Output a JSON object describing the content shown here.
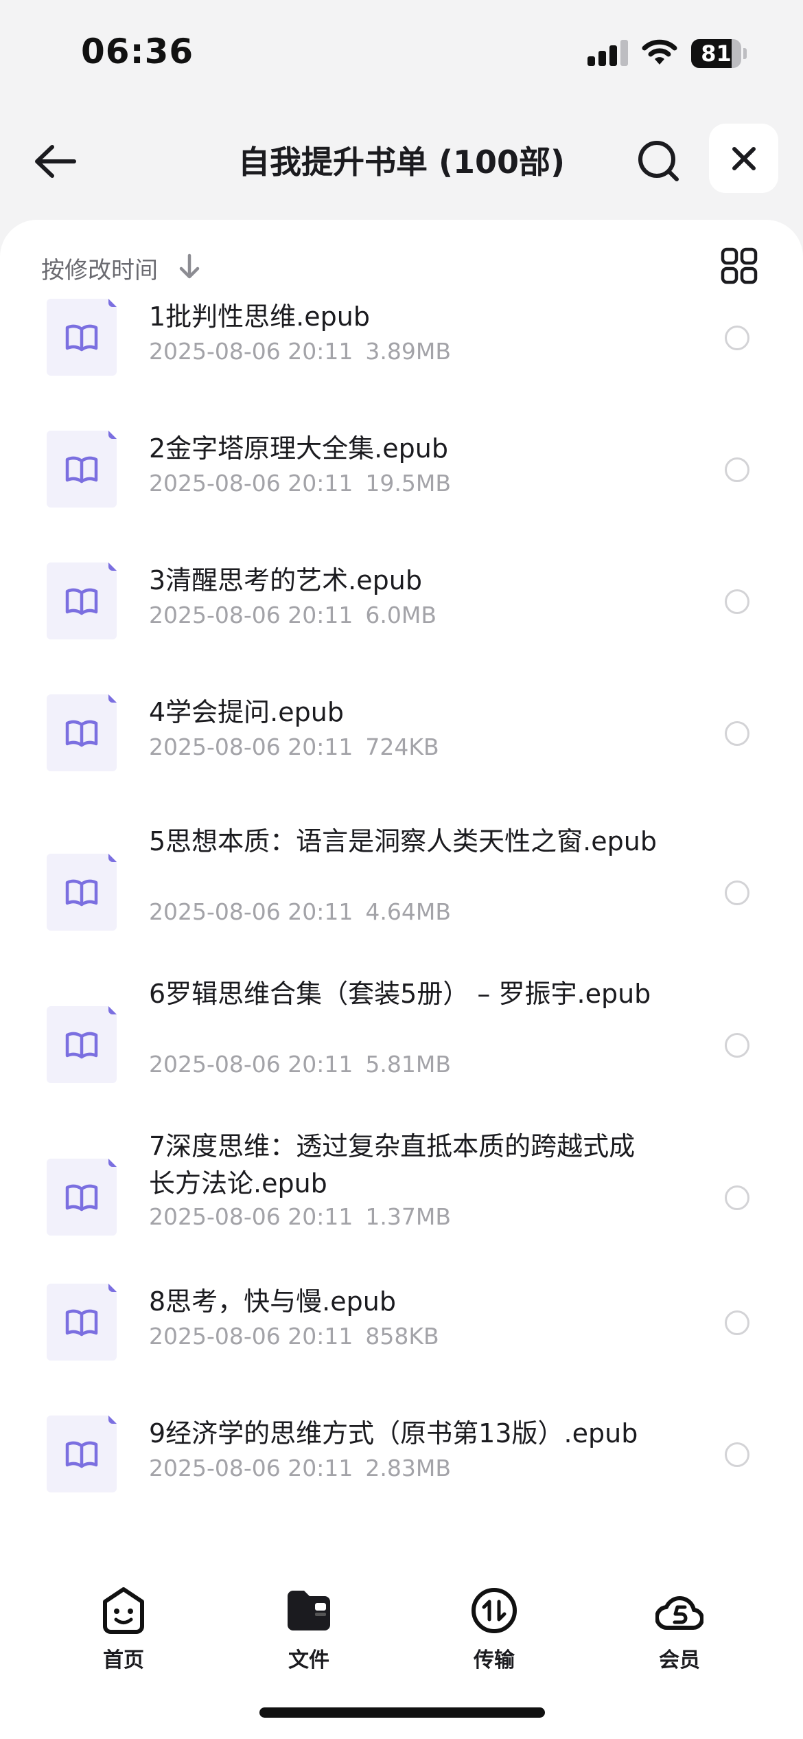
{
  "status_bar": {
    "time": "06:36",
    "battery": "81",
    "battery_level": 0.81
  },
  "nav": {
    "title": "自我提升书单 (100部)",
    "back_icon": "arrow-left-icon",
    "search_icon": "search-icon",
    "close_icon": "close-icon"
  },
  "sort": {
    "label": "按修改时间",
    "direction_icon": "arrow-down-icon",
    "view_icon": "grid-view-icon"
  },
  "files": [
    {
      "name": "1批判性思维.epub",
      "date": "2025-08-06 20:11",
      "size": "3.89MB"
    },
    {
      "name": "2金字塔原理大全集.epub",
      "date": "2025-08-06 20:11",
      "size": "19.5MB"
    },
    {
      "name": "3清醒思考的艺术.epub",
      "date": "2025-08-06 20:11",
      "size": "6.0MB"
    },
    {
      "name": "4学会提问.epub",
      "date": "2025-08-06 20:11",
      "size": "724KB"
    },
    {
      "name": "5思想本质：语言是洞察人类天性之窗.epub",
      "date": "2025-08-06 20:11",
      "size": "4.64MB"
    },
    {
      "name": "6罗辑思维合集（套装5册） – 罗振宇.epub",
      "date": "2025-08-06 20:11",
      "size": "5.81MB"
    },
    {
      "name": "7深度思维：透过复杂直抵本质的跨越式成长方法论.epub",
      "date": "2025-08-06 20:11",
      "size": "1.37MB"
    },
    {
      "name": "8思考，快与慢.epub",
      "date": "2025-08-06 20:11",
      "size": "858KB"
    },
    {
      "name": "9经济学的思维方式（原书第13版）.epub",
      "date": "2025-08-06 20:11",
      "size": "2.83MB"
    }
  ],
  "tabs": [
    {
      "label": "首页",
      "icon": "smile-icon"
    },
    {
      "label": "文件",
      "icon": "folder-icon"
    },
    {
      "label": "传输",
      "icon": "transfer-icon"
    },
    {
      "label": "会员",
      "icon": "vip-cloud-icon"
    }
  ],
  "colors": {
    "accent": "#7b6fe0",
    "background": "#f3f3f4",
    "meta_text": "#a3a3a8"
  }
}
